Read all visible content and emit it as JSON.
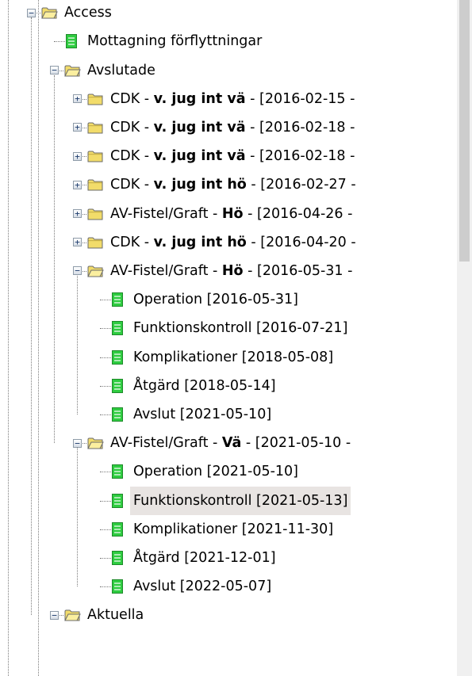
{
  "tree": {
    "nodes": [
      {
        "level": 0,
        "type": "folder-open",
        "expander": "minus",
        "parts": [
          "Access"
        ]
      },
      {
        "level": 1,
        "type": "doc",
        "parts": [
          "Mottagning förflyttningar"
        ]
      },
      {
        "level": 1,
        "type": "folder-open",
        "expander": "minus",
        "parts": [
          "Avslutade"
        ]
      },
      {
        "level": 2,
        "type": "folder",
        "expander": "plus",
        "parts": [
          "CDK - ",
          "v. jug int vä",
          " - [2016-02-15 -"
        ]
      },
      {
        "level": 2,
        "type": "folder",
        "expander": "plus",
        "parts": [
          "CDK - ",
          "v. jug int vä",
          " - [2016-02-18 -"
        ]
      },
      {
        "level": 2,
        "type": "folder",
        "expander": "plus",
        "parts": [
          "CDK - ",
          "v. jug int vä",
          " - [2016-02-18 -"
        ]
      },
      {
        "level": 2,
        "type": "folder",
        "expander": "plus",
        "parts": [
          "CDK - ",
          "v. jug int hö",
          " - [2016-02-27 -"
        ]
      },
      {
        "level": 2,
        "type": "folder",
        "expander": "plus",
        "parts": [
          "AV-Fistel/Graft - ",
          "Hö",
          " - [2016-04-26 -"
        ]
      },
      {
        "level": 2,
        "type": "folder",
        "expander": "plus",
        "parts": [
          "CDK - ",
          "v. jug int hö",
          " - [2016-04-20 -"
        ]
      },
      {
        "level": 2,
        "type": "folder-open",
        "expander": "minus",
        "parts": [
          "AV-Fistel/Graft - ",
          "Hö",
          " - [2016-05-31 -"
        ]
      },
      {
        "level": 3,
        "type": "doc",
        "parts": [
          "Operation [2016-05-31]"
        ]
      },
      {
        "level": 3,
        "type": "doc",
        "parts": [
          "Funktionskontroll [2016-07-21]"
        ]
      },
      {
        "level": 3,
        "type": "doc",
        "parts": [
          "Komplikationer [2018-05-08]"
        ]
      },
      {
        "level": 3,
        "type": "doc",
        "parts": [
          "Åtgärd [2018-05-14]"
        ]
      },
      {
        "level": 3,
        "type": "doc",
        "parts": [
          "Avslut [2021-05-10]"
        ]
      },
      {
        "level": 2,
        "type": "folder-open",
        "expander": "minus",
        "parts": [
          "AV-Fistel/Graft - ",
          "Vä",
          " - [2021-05-10 -"
        ]
      },
      {
        "level": 3,
        "type": "doc",
        "parts": [
          "Operation [2021-05-10]"
        ]
      },
      {
        "level": 3,
        "type": "doc",
        "selected": true,
        "parts": [
          "Funktionskontroll [2021-05-13]"
        ]
      },
      {
        "level": 3,
        "type": "doc",
        "parts": [
          "Komplikationer [2021-11-30]"
        ]
      },
      {
        "level": 3,
        "type": "doc",
        "parts": [
          "Åtgärd [2021-12-01]"
        ]
      },
      {
        "level": 3,
        "type": "doc",
        "parts": [
          "Avslut [2022-05-07]"
        ]
      },
      {
        "level": 1,
        "type": "folder-open",
        "expander": "minus",
        "parts": [
          "Aktuella"
        ]
      }
    ]
  },
  "colors": {
    "folder_fill": "#f2dc6a",
    "folder_edge": "#6b6b6b",
    "doc_fill": "#2ecc40",
    "selected_bg": "#e8e4e2"
  }
}
